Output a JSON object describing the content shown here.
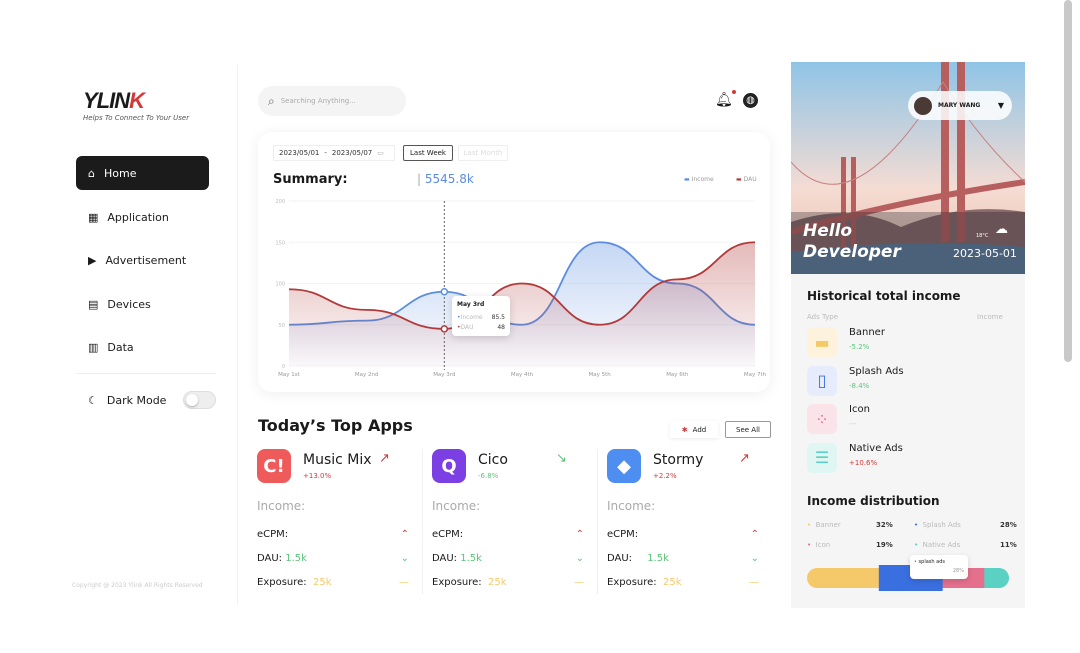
{
  "brand": {
    "name_a": "YLIN",
    "name_b": "K",
    "tagline": "Helps To Connect To Your User"
  },
  "sidebar": {
    "items": [
      {
        "label": "Home",
        "icon": "home-icon"
      },
      {
        "label": "Application",
        "icon": "grid-icon"
      },
      {
        "label": "Advertisement",
        "icon": "play-icon"
      },
      {
        "label": "Devices",
        "icon": "server-icon"
      },
      {
        "label": "Data",
        "icon": "bar-chart-icon"
      }
    ],
    "dark_mode": "Dark Mode",
    "dark_mode_on": false,
    "copyright": "Copyright @ 2023 Ylink All Rights Reserved"
  },
  "search": {
    "placeholder": "Searching Anything..."
  },
  "summary": {
    "date_from": "2023/05/01",
    "date_sep": "-",
    "date_to": "2023/05/07",
    "btn_last_week": "Last Week",
    "btn_last_month": "Last Month",
    "title": "Summary:",
    "value": "5545.8k",
    "tooltip": {
      "date": "May 3rd",
      "income_label": "Income",
      "income": "85.5",
      "dau_label": "DAU",
      "dau": "48"
    }
  },
  "chart_data": {
    "type": "area",
    "x": [
      "May 1st",
      "May 2nd",
      "May 3rd",
      "May 4th",
      "May 5th",
      "May 6th",
      "May 7th"
    ],
    "yticks": [
      "200",
      "150",
      "100",
      "50",
      "0"
    ],
    "ylim": [
      0,
      200
    ],
    "legend_placement": "top-right",
    "series": [
      {
        "name": "Income",
        "color": "#5b8de0",
        "values": [
          50,
          55,
          90,
          50,
          150,
          100,
          50
        ]
      },
      {
        "name": "DAU",
        "color": "#b23a3a",
        "values": [
          93,
          68,
          45,
          100,
          50,
          105,
          150
        ]
      }
    ]
  },
  "top_apps": {
    "title": "Today’s Top Apps",
    "add": "Add",
    "see_all": "See All",
    "income_label": "Income:",
    "ecpm_label": "eCPM:",
    "dau_label": "DAU:",
    "exposure_label": "Exposure:",
    "apps": [
      {
        "name": "Music Mix",
        "change": "+13.0%",
        "trend": "up",
        "color": "#ef5a5a",
        "glyph": "C!",
        "dau": "1.5k",
        "exposure": "25k"
      },
      {
        "name": "Cico",
        "change": "-6.8%",
        "trend": "down",
        "color": "#7b3fe4",
        "glyph": "Q",
        "dau": "1.5k",
        "exposure": "25k"
      },
      {
        "name": "Stormy",
        "change": "+2.2%",
        "trend": "up",
        "color": "#4d8ef0",
        "glyph": "◆",
        "dau": "1.5k",
        "exposure": "25k"
      }
    ]
  },
  "header": {
    "bell_icon": "bell-icon",
    "globe_icon": "globe-icon"
  },
  "profile": {
    "name": "MARY WANG",
    "greeting_1": "Hello",
    "greeting_2": "Developer",
    "date": "2023-05-01",
    "temp": "18°C"
  },
  "history": {
    "title": "Historical total income",
    "col_type": "Ads Type",
    "col_income": "Income",
    "items": [
      {
        "name": "Banner",
        "change": "-5.2%",
        "color": "#f5c96a",
        "bg": "#fdf3dc",
        "cc": "#5cc47a"
      },
      {
        "name": "Splash Ads",
        "change": "-8.4%",
        "color": "#3a6fe0",
        "bg": "#e6ecfb",
        "cc": "#5cc47a"
      },
      {
        "name": "Icon",
        "change": "---",
        "color": "#e4708e",
        "bg": "#fbe3ea",
        "cc": "#f5c96a"
      },
      {
        "name": "Native Ads",
        "change": "+10.6%",
        "color": "#5ad1c3",
        "bg": "#e0f6f3",
        "cc": "#d23a3a"
      }
    ]
  },
  "distribution": {
    "title": "Income distribution",
    "items": [
      {
        "name": "Banner",
        "pct": "32%",
        "value": 32,
        "color": "#f5c96a"
      },
      {
        "name": "Splash Ads",
        "pct": "28%",
        "value": 28,
        "color": "#3a6fe0"
      },
      {
        "name": "Icon",
        "pct": "19%",
        "value": 19,
        "color": "#e4708e"
      },
      {
        "name": "Native Ads",
        "pct": "11%",
        "value": 11,
        "color": "#5ad1c3"
      }
    ],
    "tooltip_label": "splash ads",
    "tooltip_value": "28%"
  }
}
